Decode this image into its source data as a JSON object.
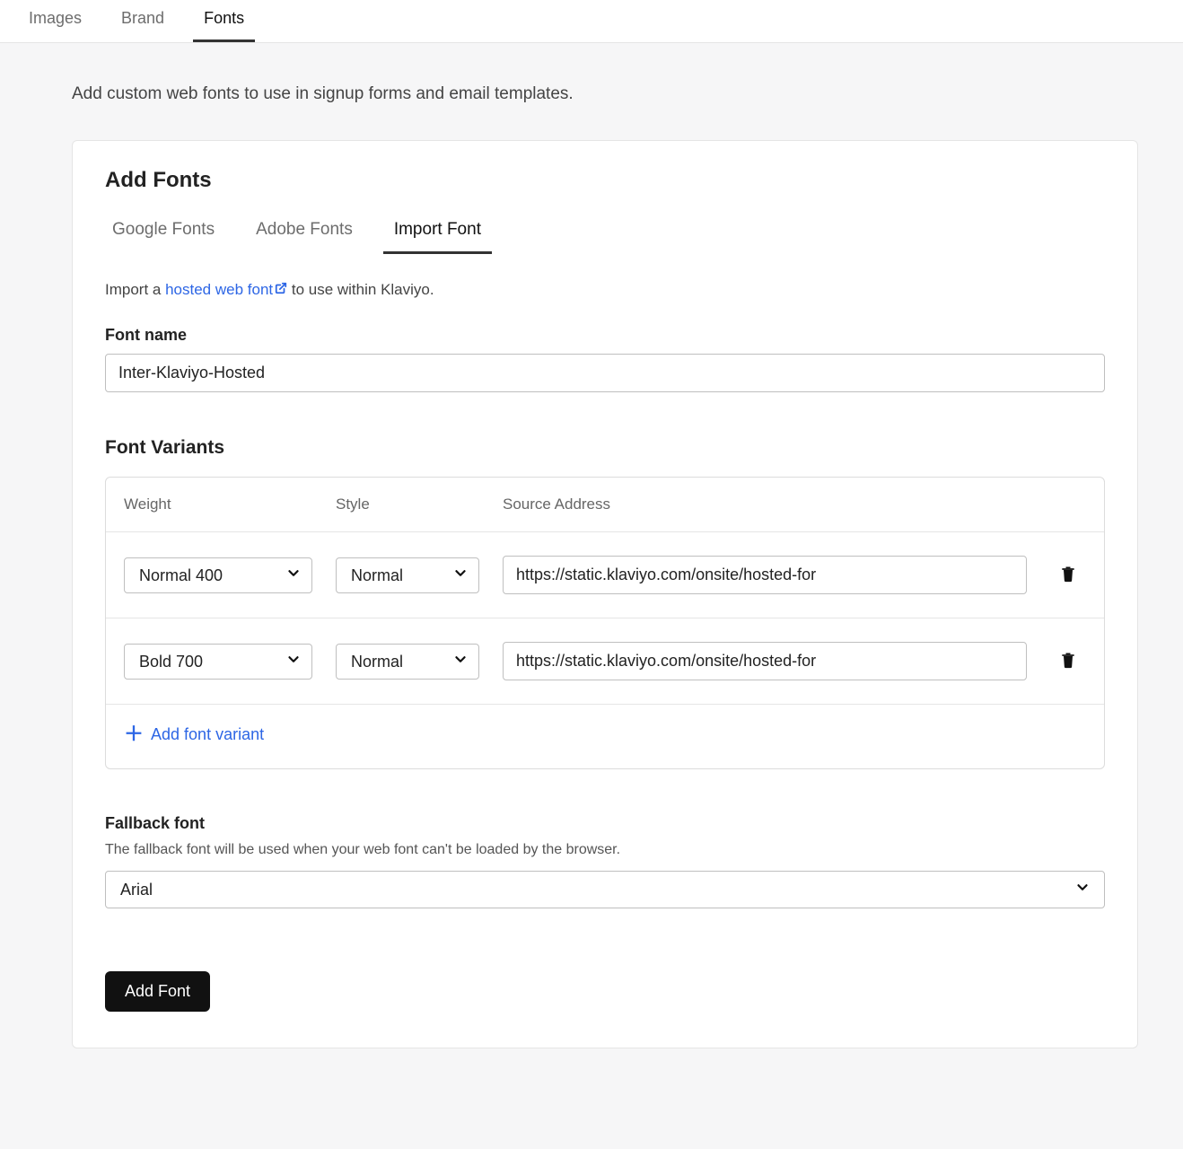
{
  "top_tabs": {
    "images": "Images",
    "brand": "Brand",
    "fonts": "Fonts"
  },
  "intro": "Add custom web fonts to use in signup forms and email templates.",
  "card": {
    "title": "Add Fonts",
    "sub_tabs": {
      "google": "Google Fonts",
      "adobe": "Adobe Fonts",
      "import": "Import Font"
    },
    "import_text_prefix": "Import a ",
    "import_link_text": "hosted web font",
    "import_text_suffix": " to use within Klaviyo.",
    "font_name_label": "Font name",
    "font_name_value": "Inter-Klaviyo-Hosted",
    "variants_heading": "Font Variants",
    "variants_headers": {
      "weight": "Weight",
      "style": "Style",
      "source": "Source Address"
    },
    "variants": [
      {
        "weight": "Normal 400",
        "style": "Normal",
        "source": "https://static.klaviyo.com/onsite/hosted-for"
      },
      {
        "weight": "Bold 700",
        "style": "Normal",
        "source": "https://static.klaviyo.com/onsite/hosted-for"
      }
    ],
    "add_variant_label": "Add font variant",
    "fallback_label": "Fallback font",
    "fallback_desc": "The fallback font will be used when your web font can't be loaded by the browser.",
    "fallback_value": "Arial",
    "add_font_button": "Add Font"
  }
}
